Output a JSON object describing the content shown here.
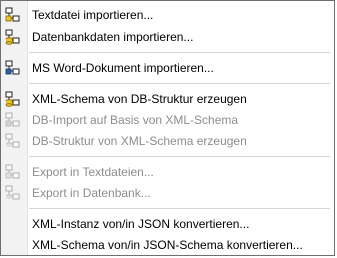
{
  "menu": {
    "items": [
      {
        "label": "Textdatei importieren...",
        "enabled": true,
        "icon": "import-text-file-icon"
      },
      {
        "label": "Datenbankdaten importieren...",
        "enabled": true,
        "icon": "import-database-icon"
      },
      {
        "label": "MS Word-Dokument importieren...",
        "enabled": true,
        "icon": "import-word-icon"
      },
      {
        "label": "XML-Schema von DB-Struktur erzeugen",
        "enabled": true,
        "icon": "schema-from-db-icon"
      },
      {
        "label": "DB-Import auf Basis von XML-Schema",
        "enabled": false,
        "icon": "db-import-schema-icon"
      },
      {
        "label": "DB-Struktur von XML-Schema erzeugen",
        "enabled": false,
        "icon": "db-structure-icon"
      },
      {
        "label": "Export in Textdateien...",
        "enabled": false,
        "icon": "export-text-icon"
      },
      {
        "label": "Export in Datenbank...",
        "enabled": false,
        "icon": "export-database-icon"
      },
      {
        "label": "XML-Instanz von/in JSON konvertieren...",
        "enabled": true,
        "icon": "convert-json-instance-icon"
      },
      {
        "label": "XML-Schema von/in JSON-Schema konvertieren...",
        "enabled": true,
        "icon": "convert-json-schema-icon"
      }
    ]
  },
  "colors": {
    "enabled_text": "#000000",
    "disabled_text": "#8d8d8d",
    "icon_yellow": "#f0c419",
    "icon_green": "#3a9a3a"
  }
}
